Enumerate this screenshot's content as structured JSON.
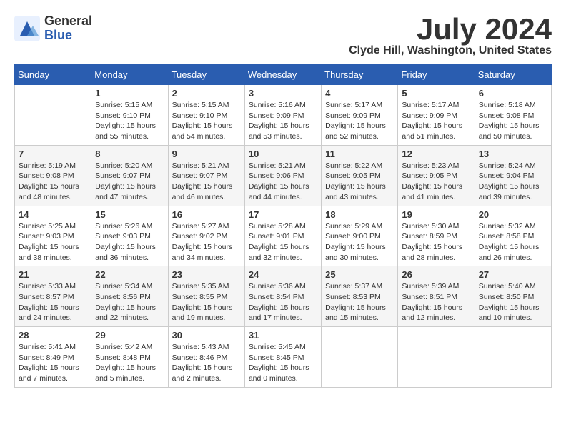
{
  "header": {
    "logo_general": "General",
    "logo_blue": "Blue",
    "month_year": "July 2024",
    "location": "Clyde Hill, Washington, United States"
  },
  "weekdays": [
    "Sunday",
    "Monday",
    "Tuesday",
    "Wednesday",
    "Thursday",
    "Friday",
    "Saturday"
  ],
  "weeks": [
    [
      {
        "day": "",
        "content": ""
      },
      {
        "day": "1",
        "content": "Sunrise: 5:15 AM\nSunset: 9:10 PM\nDaylight: 15 hours\nand 55 minutes."
      },
      {
        "day": "2",
        "content": "Sunrise: 5:15 AM\nSunset: 9:10 PM\nDaylight: 15 hours\nand 54 minutes."
      },
      {
        "day": "3",
        "content": "Sunrise: 5:16 AM\nSunset: 9:09 PM\nDaylight: 15 hours\nand 53 minutes."
      },
      {
        "day": "4",
        "content": "Sunrise: 5:17 AM\nSunset: 9:09 PM\nDaylight: 15 hours\nand 52 minutes."
      },
      {
        "day": "5",
        "content": "Sunrise: 5:17 AM\nSunset: 9:09 PM\nDaylight: 15 hours\nand 51 minutes."
      },
      {
        "day": "6",
        "content": "Sunrise: 5:18 AM\nSunset: 9:08 PM\nDaylight: 15 hours\nand 50 minutes."
      }
    ],
    [
      {
        "day": "7",
        "content": "Sunrise: 5:19 AM\nSunset: 9:08 PM\nDaylight: 15 hours\nand 48 minutes."
      },
      {
        "day": "8",
        "content": "Sunrise: 5:20 AM\nSunset: 9:07 PM\nDaylight: 15 hours\nand 47 minutes."
      },
      {
        "day": "9",
        "content": "Sunrise: 5:21 AM\nSunset: 9:07 PM\nDaylight: 15 hours\nand 46 minutes."
      },
      {
        "day": "10",
        "content": "Sunrise: 5:21 AM\nSunset: 9:06 PM\nDaylight: 15 hours\nand 44 minutes."
      },
      {
        "day": "11",
        "content": "Sunrise: 5:22 AM\nSunset: 9:05 PM\nDaylight: 15 hours\nand 43 minutes."
      },
      {
        "day": "12",
        "content": "Sunrise: 5:23 AM\nSunset: 9:05 PM\nDaylight: 15 hours\nand 41 minutes."
      },
      {
        "day": "13",
        "content": "Sunrise: 5:24 AM\nSunset: 9:04 PM\nDaylight: 15 hours\nand 39 minutes."
      }
    ],
    [
      {
        "day": "14",
        "content": "Sunrise: 5:25 AM\nSunset: 9:03 PM\nDaylight: 15 hours\nand 38 minutes."
      },
      {
        "day": "15",
        "content": "Sunrise: 5:26 AM\nSunset: 9:03 PM\nDaylight: 15 hours\nand 36 minutes."
      },
      {
        "day": "16",
        "content": "Sunrise: 5:27 AM\nSunset: 9:02 PM\nDaylight: 15 hours\nand 34 minutes."
      },
      {
        "day": "17",
        "content": "Sunrise: 5:28 AM\nSunset: 9:01 PM\nDaylight: 15 hours\nand 32 minutes."
      },
      {
        "day": "18",
        "content": "Sunrise: 5:29 AM\nSunset: 9:00 PM\nDaylight: 15 hours\nand 30 minutes."
      },
      {
        "day": "19",
        "content": "Sunrise: 5:30 AM\nSunset: 8:59 PM\nDaylight: 15 hours\nand 28 minutes."
      },
      {
        "day": "20",
        "content": "Sunrise: 5:32 AM\nSunset: 8:58 PM\nDaylight: 15 hours\nand 26 minutes."
      }
    ],
    [
      {
        "day": "21",
        "content": "Sunrise: 5:33 AM\nSunset: 8:57 PM\nDaylight: 15 hours\nand 24 minutes."
      },
      {
        "day": "22",
        "content": "Sunrise: 5:34 AM\nSunset: 8:56 PM\nDaylight: 15 hours\nand 22 minutes."
      },
      {
        "day": "23",
        "content": "Sunrise: 5:35 AM\nSunset: 8:55 PM\nDaylight: 15 hours\nand 19 minutes."
      },
      {
        "day": "24",
        "content": "Sunrise: 5:36 AM\nSunset: 8:54 PM\nDaylight: 15 hours\nand 17 minutes."
      },
      {
        "day": "25",
        "content": "Sunrise: 5:37 AM\nSunset: 8:53 PM\nDaylight: 15 hours\nand 15 minutes."
      },
      {
        "day": "26",
        "content": "Sunrise: 5:39 AM\nSunset: 8:51 PM\nDaylight: 15 hours\nand 12 minutes."
      },
      {
        "day": "27",
        "content": "Sunrise: 5:40 AM\nSunset: 8:50 PM\nDaylight: 15 hours\nand 10 minutes."
      }
    ],
    [
      {
        "day": "28",
        "content": "Sunrise: 5:41 AM\nSunset: 8:49 PM\nDaylight: 15 hours\nand 7 minutes."
      },
      {
        "day": "29",
        "content": "Sunrise: 5:42 AM\nSunset: 8:48 PM\nDaylight: 15 hours\nand 5 minutes."
      },
      {
        "day": "30",
        "content": "Sunrise: 5:43 AM\nSunset: 8:46 PM\nDaylight: 15 hours\nand 2 minutes."
      },
      {
        "day": "31",
        "content": "Sunrise: 5:45 AM\nSunset: 8:45 PM\nDaylight: 15 hours\nand 0 minutes."
      },
      {
        "day": "",
        "content": ""
      },
      {
        "day": "",
        "content": ""
      },
      {
        "day": "",
        "content": ""
      }
    ]
  ]
}
